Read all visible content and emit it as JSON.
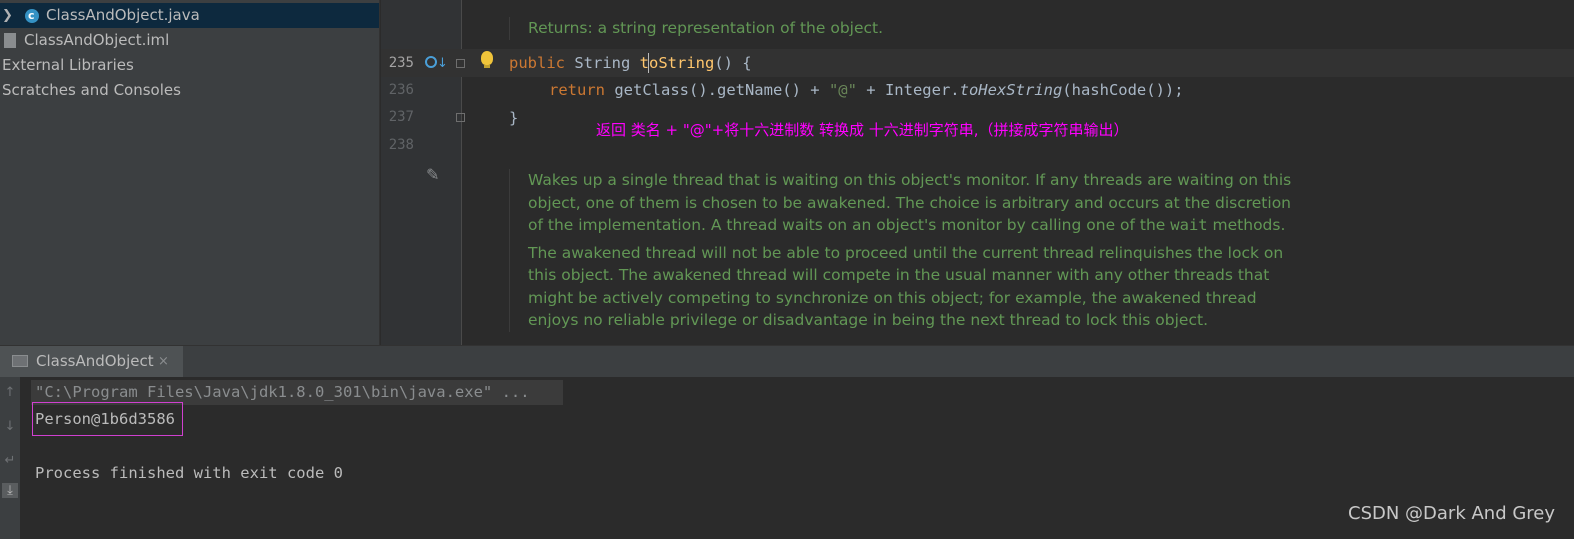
{
  "project_tree": {
    "items": [
      {
        "label": "ClassAndObject.java",
        "icon": "java-class-icon",
        "selected": true
      },
      {
        "label": "ClassAndObject.iml",
        "icon": "iml-file-icon"
      },
      {
        "label": "External Libraries"
      },
      {
        "label": "Scratches and Consoles"
      }
    ]
  },
  "editor": {
    "doc_top": "Returns: a string representation of the object.",
    "line_numbers": [
      "235",
      "236",
      "237",
      "238"
    ],
    "line235": {
      "kw": "public",
      "type": " String ",
      "method": "toString",
      "rest": "() {"
    },
    "line236": {
      "kw": "return",
      "part1": " getClass().getName() + ",
      "str": "\"@\"",
      "part2": " + Integer.",
      "italic": "toHexString",
      "part3": "(hashCode());"
    },
    "line237": "}",
    "annotation": "返回  类名 + \"@\"+将十六进制数 转换成 十六进制字符串,（拼接成字符串输出）",
    "doc_notify": {
      "p1_a": "Wakes up a single thread that is waiting on this object's monitor. If any threads are waiting on this object, one of them is chosen to be awakened. The choice is arbitrary and occurs at the discretion of the implementation. A thread waits on an object's monitor by calling one of the ",
      "p1_code": "wait",
      "p1_b": " methods.",
      "p2": "The awakened thread will not be able to proceed until the current thread relinquishes the lock on this object. The awakened thread will compete in the usual manner with any other threads that might be actively competing to synchronize on this object; for example, the awakened thread enjoys no reliable privilege or disadvantage in being the next thread to lock this object."
    }
  },
  "run_panel": {
    "tab_label": "ClassAndObject",
    "close_glyph": "×",
    "command": "\"C:\\Program Files\\Java\\jdk1.8.0_301\\bin\\java.exe\" ...",
    "output": "Person@1b6d3586",
    "exit_message": "Process finished with exit code 0"
  },
  "watermark": "CSDN @Dark And Grey",
  "colors": {
    "keyword": "#cc7832",
    "method": "#ffc66d",
    "string": "#6a8759",
    "doc": "#629755",
    "annotation": "#ff00ff"
  }
}
